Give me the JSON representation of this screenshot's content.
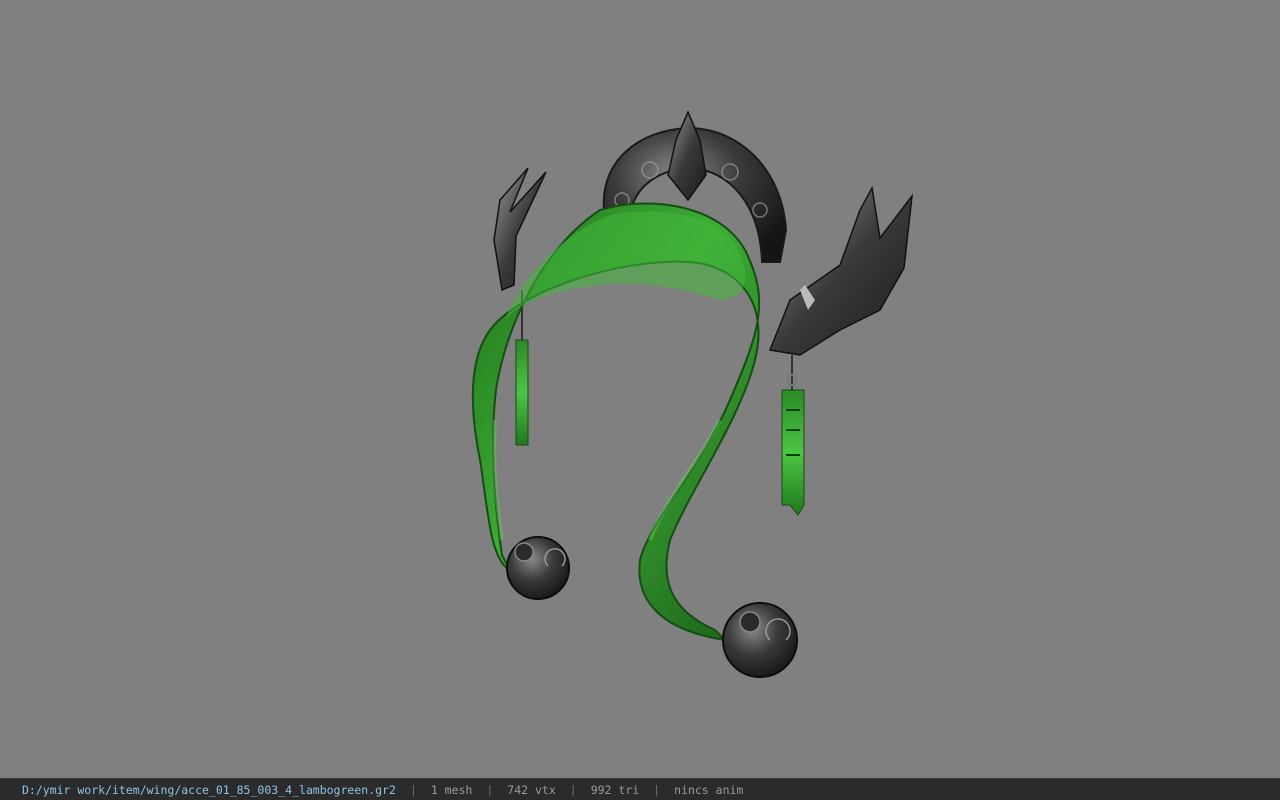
{
  "viewport": {
    "background": "#808080",
    "model": {
      "name": "acce_01_85_003_4_lambogreen",
      "scarf_color": "#2f9a2a",
      "metal_color": "#3c3c3c"
    }
  },
  "statusbar": {
    "path": "D:/ymir work/item/wing/acce_01_85_003_4_lambogreen.gr2",
    "separator": "|",
    "mesh": "1 mesh",
    "vertices": "742 vtx",
    "triangles": "992 tri",
    "animation": "nincs anim"
  }
}
